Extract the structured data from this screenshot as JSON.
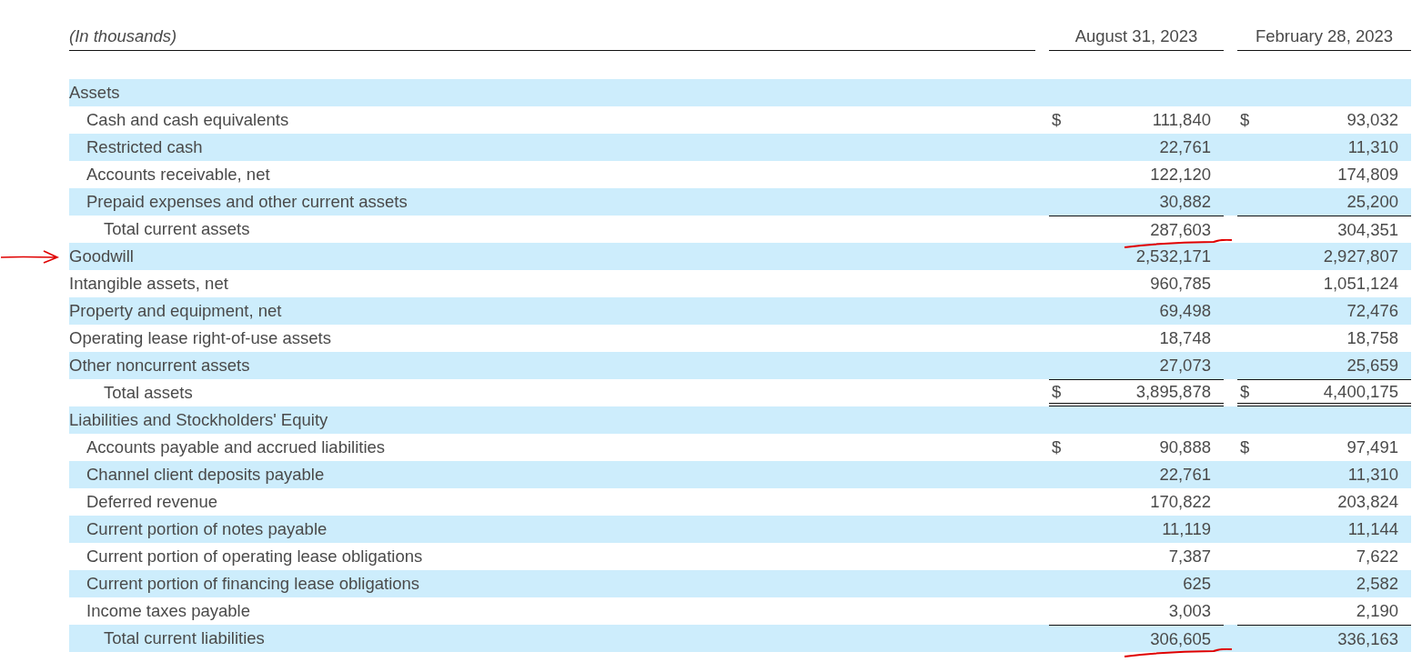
{
  "table": {
    "columns": [
      {
        "label": "(In thousands)"
      },
      {
        "label": "August 31, 2023"
      },
      {
        "label": "February 28, 2023"
      }
    ],
    "rows": [
      {
        "kind": "section",
        "label": "Assets",
        "values": []
      },
      {
        "kind": "item",
        "label": "Cash and cash equivalents",
        "values": [
          {
            "currency": "$",
            "amount": "111,840"
          },
          {
            "currency": "$",
            "amount": "93,032"
          }
        ]
      },
      {
        "kind": "item",
        "label": "Restricted cash",
        "values": [
          {
            "amount": "22,761"
          },
          {
            "amount": "11,310"
          }
        ]
      },
      {
        "kind": "item",
        "label": "Accounts receivable, net",
        "values": [
          {
            "amount": "122,120"
          },
          {
            "amount": "174,809"
          }
        ]
      },
      {
        "kind": "item",
        "label": "Prepaid expenses and other current assets",
        "values": [
          {
            "amount": "30,882"
          },
          {
            "amount": "25,200"
          }
        ]
      },
      {
        "kind": "subtotal",
        "label": "Total current assets",
        "values": [
          {
            "amount": "287,603",
            "underlined": true
          },
          {
            "amount": "304,351"
          }
        ]
      },
      {
        "kind": "top",
        "label": "Goodwill",
        "arrow_marked": true,
        "values": [
          {
            "amount": "2,532,171"
          },
          {
            "amount": "2,927,807"
          }
        ]
      },
      {
        "kind": "top",
        "label": "Intangible assets, net",
        "values": [
          {
            "amount": "960,785"
          },
          {
            "amount": "1,051,124"
          }
        ]
      },
      {
        "kind": "top",
        "label": "Property and equipment, net",
        "values": [
          {
            "amount": "69,498"
          },
          {
            "amount": "72,476"
          }
        ]
      },
      {
        "kind": "top",
        "label": "Operating lease right-of-use assets",
        "values": [
          {
            "amount": "18,748"
          },
          {
            "amount": "18,758"
          }
        ]
      },
      {
        "kind": "top",
        "label": "Other noncurrent assets",
        "values": [
          {
            "amount": "27,073"
          },
          {
            "amount": "25,659"
          }
        ]
      },
      {
        "kind": "total",
        "label": "Total assets",
        "values": [
          {
            "currency": "$",
            "amount": "3,895,878"
          },
          {
            "currency": "$",
            "amount": "4,400,175"
          }
        ]
      },
      {
        "kind": "section",
        "label": "Liabilities and Stockholders' Equity",
        "values": []
      },
      {
        "kind": "item",
        "label": "Accounts payable and accrued liabilities",
        "values": [
          {
            "currency": "$",
            "amount": "90,888"
          },
          {
            "currency": "$",
            "amount": "97,491"
          }
        ]
      },
      {
        "kind": "item",
        "label": "Channel client deposits payable",
        "values": [
          {
            "amount": "22,761"
          },
          {
            "amount": "11,310"
          }
        ]
      },
      {
        "kind": "item",
        "label": "Deferred revenue",
        "values": [
          {
            "amount": "170,822"
          },
          {
            "amount": "203,824"
          }
        ]
      },
      {
        "kind": "item",
        "label": "Current portion of notes payable",
        "values": [
          {
            "amount": "11,119"
          },
          {
            "amount": "11,144"
          }
        ]
      },
      {
        "kind": "item",
        "label": "Current portion of operating lease obligations",
        "values": [
          {
            "amount": "7,387"
          },
          {
            "amount": "7,622"
          }
        ]
      },
      {
        "kind": "item",
        "label": "Current portion of financing lease obligations",
        "values": [
          {
            "amount": "625"
          },
          {
            "amount": "2,582"
          }
        ]
      },
      {
        "kind": "item",
        "label": "Income taxes payable",
        "values": [
          {
            "amount": "3,003"
          },
          {
            "amount": "2,190"
          }
        ]
      },
      {
        "kind": "subtotal",
        "label": "Total current liabilities",
        "values": [
          {
            "amount": "306,605",
            "underlined": true
          },
          {
            "amount": "336,163"
          }
        ]
      }
    ]
  }
}
